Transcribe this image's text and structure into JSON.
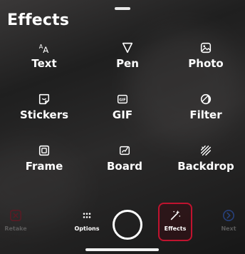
{
  "panel": {
    "title": "Effects"
  },
  "tools": [
    {
      "label": "Text",
      "icon": "text-size-icon"
    },
    {
      "label": "Pen",
      "icon": "pen-icon"
    },
    {
      "label": "Photo",
      "icon": "photo-icon"
    },
    {
      "label": "Stickers",
      "icon": "sticker-icon"
    },
    {
      "label": "GIF",
      "icon": "gif-icon"
    },
    {
      "label": "Filter",
      "icon": "filter-icon"
    },
    {
      "label": "Frame",
      "icon": "frame-icon"
    },
    {
      "label": "Board",
      "icon": "board-icon"
    },
    {
      "label": "Backdrop",
      "icon": "backdrop-icon"
    }
  ],
  "bottom_bar": {
    "retake_label": "Retake",
    "options_label": "Options",
    "effects_label": "Effects",
    "next_label": "Next"
  },
  "colors": {
    "active_border": "#c0132f",
    "disabled_text": "#5b5b5b",
    "disabled_red": "#5a1b24",
    "disabled_blue": "#27407a"
  }
}
